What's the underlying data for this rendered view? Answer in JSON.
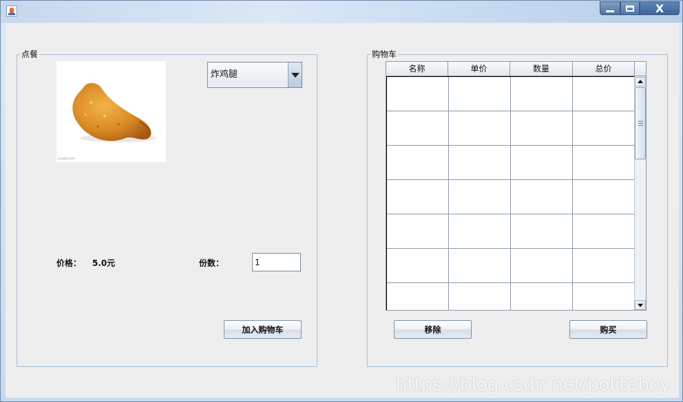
{
  "window": {
    "title": "",
    "controls": [
      "minimize-icon",
      "maximize-icon",
      "close-icon"
    ],
    "close_glyph": "X"
  },
  "order_panel": {
    "title": "点餐",
    "image_caption": "pixabay.com",
    "food_combo": {
      "selected": "炸鸡腿"
    },
    "price_label": "价格：",
    "price_value": "5.0元",
    "quantity_label": "份数：",
    "quantity_value": "1",
    "add_button": "加入购物车"
  },
  "cart_panel": {
    "title": "购物车",
    "columns": [
      "名称",
      "单价",
      "数量",
      "总价"
    ],
    "rows": [
      [
        "",
        "",
        "",
        ""
      ],
      [
        "",
        "",
        "",
        ""
      ],
      [
        "",
        "",
        "",
        ""
      ],
      [
        "",
        "",
        "",
        ""
      ],
      [
        "",
        "",
        "",
        ""
      ],
      [
        "",
        "",
        "",
        ""
      ],
      [
        "",
        "",
        "",
        ""
      ]
    ],
    "remove_button": "移除",
    "buy_button": "购买"
  },
  "watermark": "https://blog.csdn.net/politeboy",
  "colors": {
    "background": "#eeeeee",
    "border": "#a9bfd6",
    "titlebar": "#c6d8ee"
  }
}
